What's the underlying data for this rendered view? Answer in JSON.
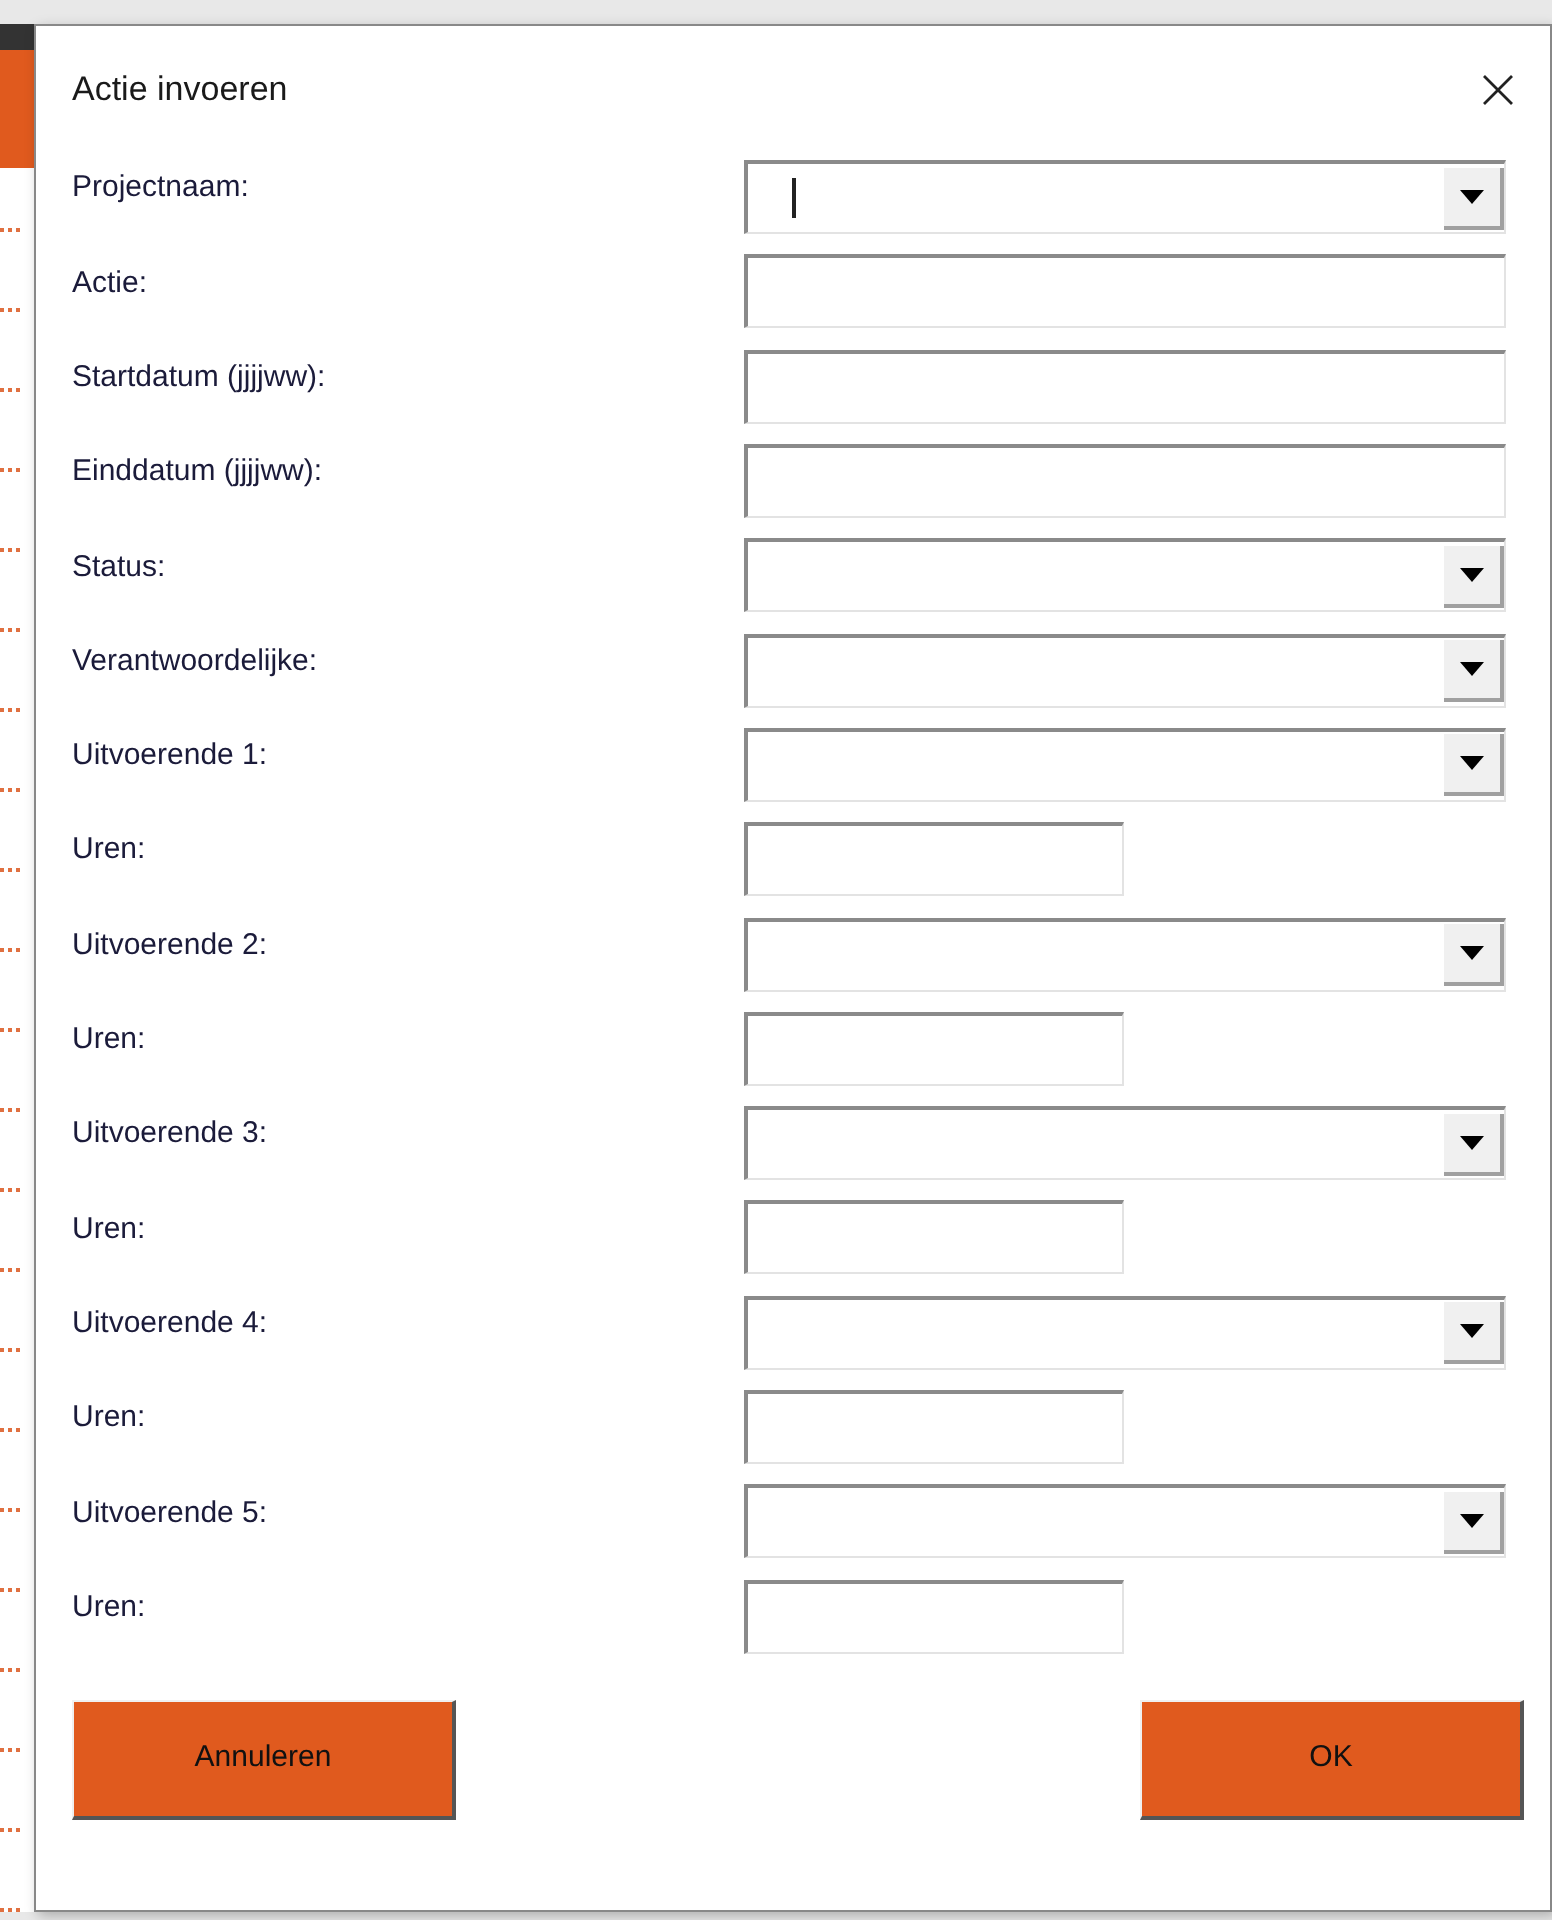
{
  "window": {
    "title": "Actie invoeren"
  },
  "fields": [
    {
      "label": "Projectnaam:",
      "kind": "dropdown",
      "focused": true
    },
    {
      "label": "Actie:",
      "kind": "text",
      "focused": false
    },
    {
      "label": "Startdatum (jjjjww):",
      "kind": "text",
      "focused": false
    },
    {
      "label": "Einddatum (jjjjww):",
      "kind": "text",
      "focused": false
    },
    {
      "label": "Status:",
      "kind": "dropdown",
      "focused": false
    },
    {
      "label": "Verantwoordelijke:",
      "kind": "dropdown",
      "focused": false
    },
    {
      "label": "Uitvoerende 1:",
      "kind": "dropdown",
      "focused": false
    },
    {
      "label": "Uren:",
      "kind": "short",
      "focused": false
    },
    {
      "label": "Uitvoerende 2:",
      "kind": "dropdown",
      "focused": false
    },
    {
      "label": "Uren:",
      "kind": "short",
      "focused": false
    },
    {
      "label": "Uitvoerende 3:",
      "kind": "dropdown",
      "focused": false
    },
    {
      "label": "Uren:",
      "kind": "short",
      "focused": false
    },
    {
      "label": "Uitvoerende 4:",
      "kind": "dropdown",
      "focused": false
    },
    {
      "label": "Uren:",
      "kind": "short",
      "focused": false
    },
    {
      "label": "Uitvoerende 5:",
      "kind": "dropdown",
      "focused": false
    },
    {
      "label": "Uren:",
      "kind": "short",
      "focused": false
    }
  ],
  "buttons": [
    "Annuleren",
    "OK"
  ]
}
